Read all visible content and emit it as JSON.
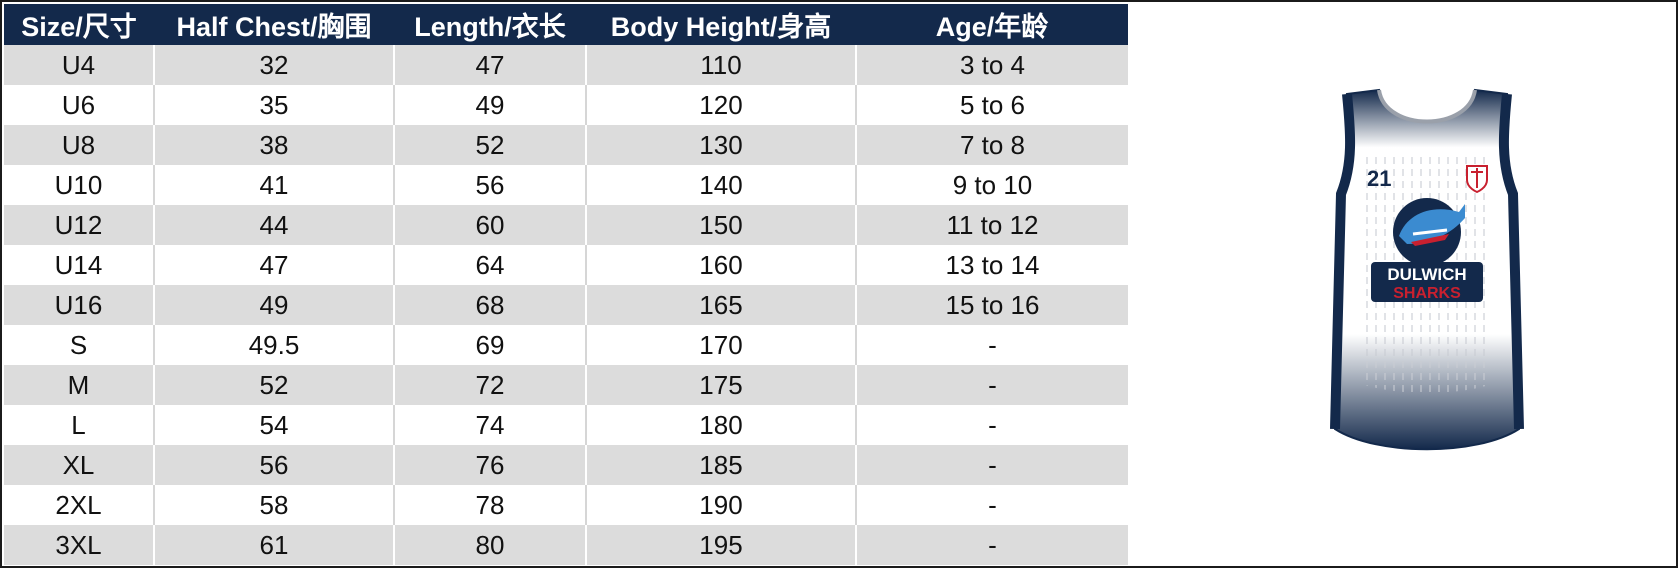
{
  "table": {
    "headers": [
      "Size/尺寸",
      "Half Chest/胸围",
      "Length/衣长",
      "Body Height/身高",
      "Age/年龄"
    ],
    "rows": [
      [
        "U4",
        "32",
        "47",
        "110",
        "3 to 4"
      ],
      [
        "U6",
        "35",
        "49",
        "120",
        "5 to 6"
      ],
      [
        "U8",
        "38",
        "52",
        "130",
        "7 to 8"
      ],
      [
        "U10",
        "41",
        "56",
        "140",
        "9 to 10"
      ],
      [
        "U12",
        "44",
        "60",
        "150",
        "11 to 12"
      ],
      [
        "U14",
        "47",
        "64",
        "160",
        "13 to 14"
      ],
      [
        "U16",
        "49",
        "68",
        "165",
        "15 to 16"
      ],
      [
        "S",
        "49.5",
        "69",
        "170",
        "-"
      ],
      [
        "M",
        "52",
        "72",
        "175",
        "-"
      ],
      [
        "L",
        "54",
        "74",
        "180",
        "-"
      ],
      [
        "XL",
        "56",
        "76",
        "185",
        "-"
      ],
      [
        "2XL",
        "58",
        "78",
        "190",
        "-"
      ],
      [
        "3XL",
        "61",
        "80",
        "195",
        "-"
      ]
    ]
  },
  "jersey": {
    "number": "21",
    "logo_line1": "DULWICH",
    "logo_line2": "SHARKS",
    "colors": {
      "navy": "#13294b",
      "red": "#c8202f",
      "white": "#ffffff"
    }
  }
}
